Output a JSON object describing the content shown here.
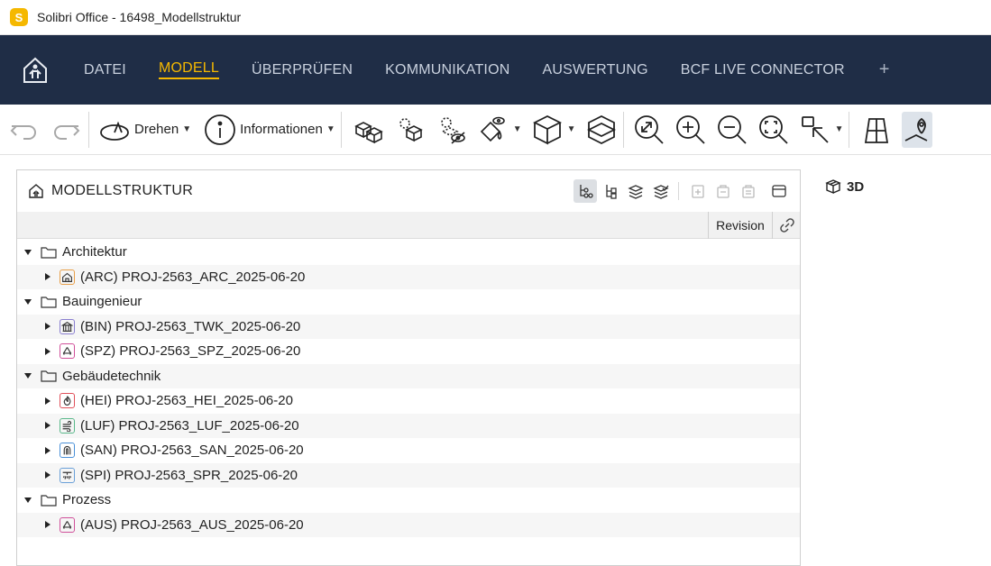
{
  "window": {
    "title": "Solibri Office - 16498_Modellstruktur",
    "logo_letter": "S"
  },
  "menu": [
    {
      "label": "DATEI",
      "active": false
    },
    {
      "label": "MODELL",
      "active": true
    },
    {
      "label": "ÜBERPRÜFEN",
      "active": false
    },
    {
      "label": "KOMMUNIKATION",
      "active": false
    },
    {
      "label": "AUSWERTUNG",
      "active": false
    },
    {
      "label": "BCF LIVE CONNECTOR",
      "active": false
    }
  ],
  "menu_add": "+",
  "toolbar": {
    "rotate_label": "Drehen",
    "info_label": "Informationen"
  },
  "panel": {
    "title": "MODELLSTRUKTUR",
    "col_revision": "Revision"
  },
  "tab_3d": "3D",
  "tree": [
    {
      "label": "Architektur",
      "children": [
        {
          "label": "(ARC) PROJ-2563_ARC_2025-06-20",
          "icon": "house-icon",
          "color": "#e8a04a"
        }
      ]
    },
    {
      "label": "Bauingenieur",
      "children": [
        {
          "label": "(BIN) PROJ-2563_TWK_2025-06-20",
          "icon": "building-icon",
          "color": "#8a7fd0"
        },
        {
          "label": "(SPZ) PROJ-2563_SPZ_2025-06-20",
          "icon": "recycle-icon",
          "color": "#d0509a"
        }
      ]
    },
    {
      "label": "Gebäudetechnik",
      "children": [
        {
          "label": "(HEI) PROJ-2563_HEI_2025-06-20",
          "icon": "flame-icon",
          "color": "#e0505a"
        },
        {
          "label": "(LUF) PROJ-2563_LUF_2025-06-20",
          "icon": "wind-icon",
          "color": "#5ab88a"
        },
        {
          "label": "(SAN) PROJ-2563_SAN_2025-06-20",
          "icon": "pipe-icon",
          "color": "#4a90d8"
        },
        {
          "label": "(SPI) PROJ-2563_SPR_2025-06-20",
          "icon": "sprinkler-icon",
          "color": "#6aa0d8"
        }
      ]
    },
    {
      "label": "Prozess",
      "children": [
        {
          "label": "(AUS) PROJ-2563_AUS_2025-06-20",
          "icon": "recycle-icon",
          "color": "#d0509a"
        }
      ]
    }
  ]
}
